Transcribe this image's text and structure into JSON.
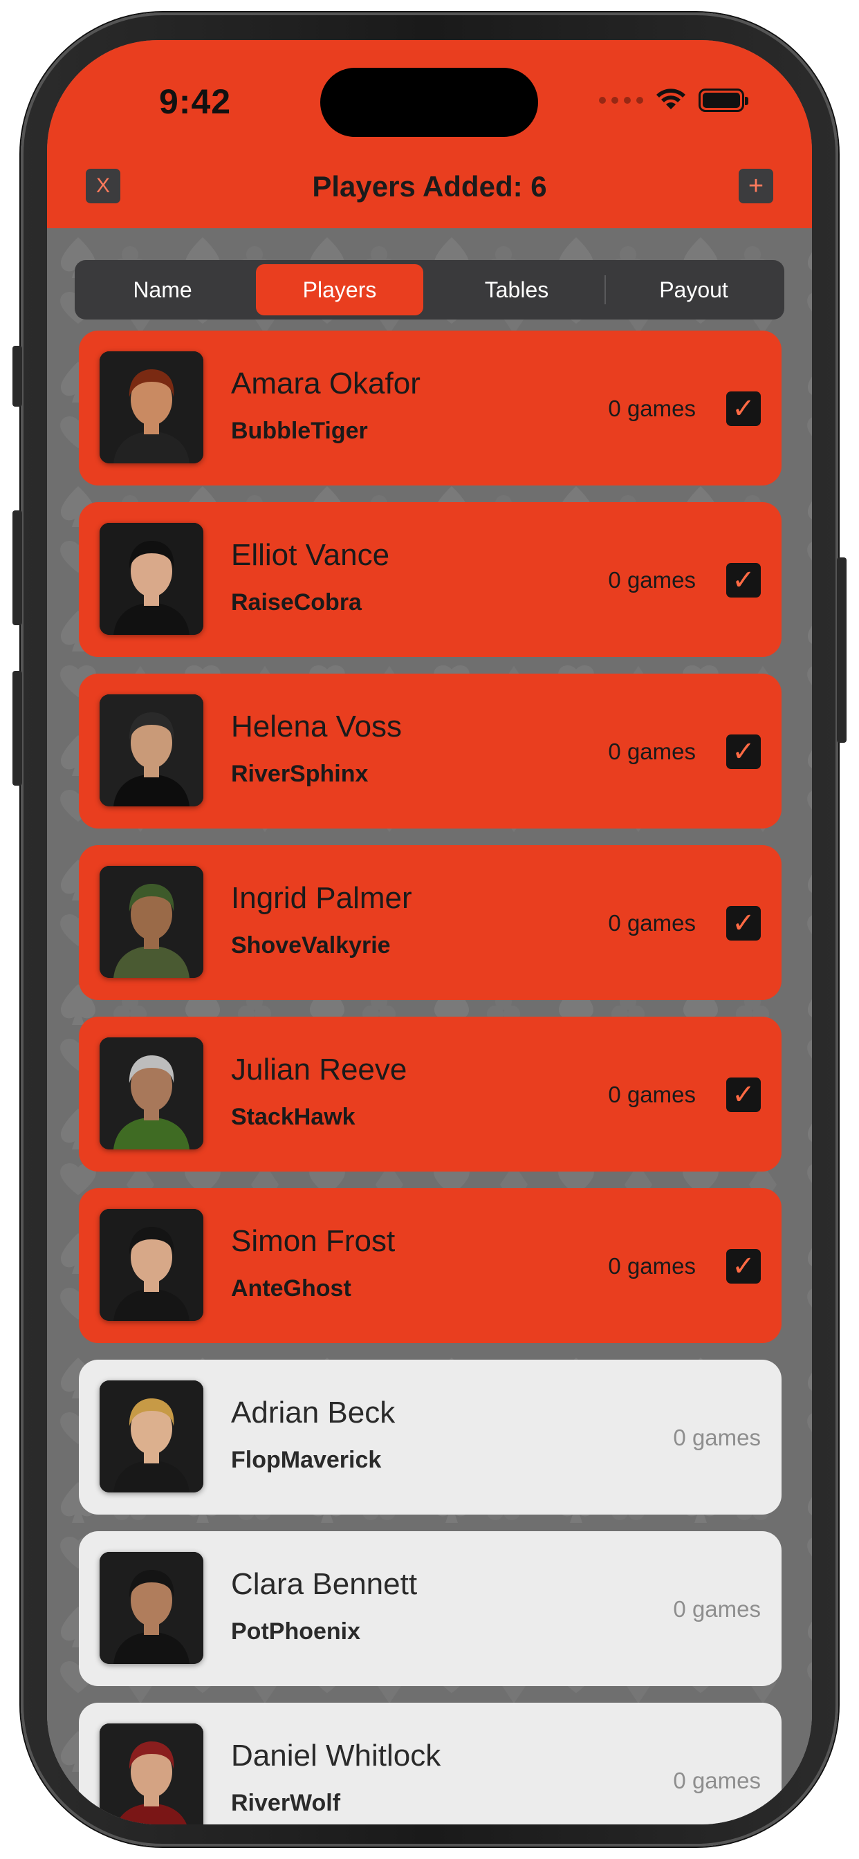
{
  "status_bar": {
    "time": "9:42"
  },
  "header": {
    "title": "Players Added: 6",
    "close_label": "X",
    "add_label": "+"
  },
  "tabs": [
    {
      "label": "Name",
      "active": false
    },
    {
      "label": "Players",
      "active": true
    },
    {
      "label": "Tables",
      "active": false
    },
    {
      "label": "Payout",
      "active": false
    }
  ],
  "players": [
    {
      "name": "Amara Okafor",
      "username": "BubbleTiger",
      "games": "0 games",
      "selected": true
    },
    {
      "name": "Elliot Vance",
      "username": "RaiseCobra",
      "games": "0 games",
      "selected": true
    },
    {
      "name": "Helena Voss",
      "username": "RiverSphinx",
      "games": "0 games",
      "selected": true
    },
    {
      "name": "Ingrid Palmer",
      "username": "ShoveValkyrie",
      "games": "0 games",
      "selected": true
    },
    {
      "name": "Julian Reeve",
      "username": "StackHawk",
      "games": "0 games",
      "selected": true
    },
    {
      "name": "Simon Frost",
      "username": "AnteGhost",
      "games": "0 games",
      "selected": true
    },
    {
      "name": "Adrian Beck",
      "username": "FlopMaverick",
      "games": "0 games",
      "selected": false
    },
    {
      "name": "Clara Bennett",
      "username": "PotPhoenix",
      "games": "0 games",
      "selected": false
    },
    {
      "name": "Daniel Whitlock",
      "username": "RiverWolf",
      "games": "0 games",
      "selected": false
    }
  ],
  "check_glyph": "✓",
  "colors": {
    "accent": "#e93e1f",
    "unselected_card": "#ececec",
    "segment_bg": "#3a3a3c"
  }
}
